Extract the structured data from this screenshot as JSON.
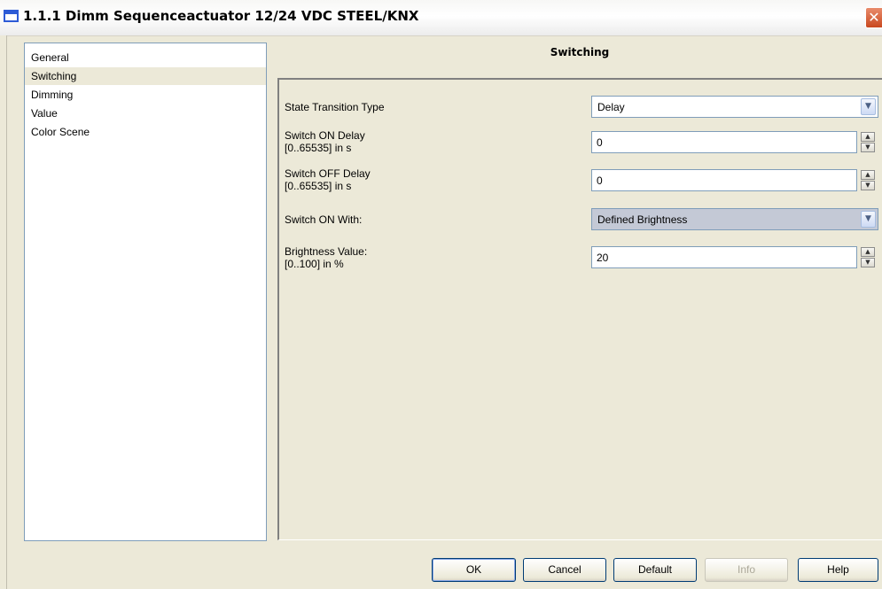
{
  "window": {
    "title": "1.1.1 Dimm Sequenceactuator 12/24 VDC STEEL/KNX",
    "close_icon": "close-icon"
  },
  "nav": {
    "items": [
      {
        "label": "General",
        "selected": false
      },
      {
        "label": "Switching",
        "selected": true
      },
      {
        "label": "Dimming",
        "selected": false
      },
      {
        "label": "Value",
        "selected": false
      },
      {
        "label": "Color Scene",
        "selected": false
      }
    ]
  },
  "panel": {
    "title": "Switching",
    "params": {
      "state_transition": {
        "label": "State Transition Type",
        "value": "Delay"
      },
      "switch_on_delay": {
        "label_line1": "Switch ON Delay",
        "label_line2": "[0..65535] in s",
        "value": "0"
      },
      "switch_off_delay": {
        "label_line1": "Switch OFF Delay",
        "label_line2": "[0..65535] in s",
        "value": "0"
      },
      "switch_on_with": {
        "label": "Switch ON With:",
        "value": "Defined Brightness"
      },
      "brightness_value": {
        "label_line1": "Brightness Value:",
        "label_line2": "[0..100] in %",
        "value": "20"
      }
    }
  },
  "buttons": {
    "ok": "OK",
    "cancel": "Cancel",
    "default": "Default",
    "info": "Info",
    "help": "Help"
  }
}
